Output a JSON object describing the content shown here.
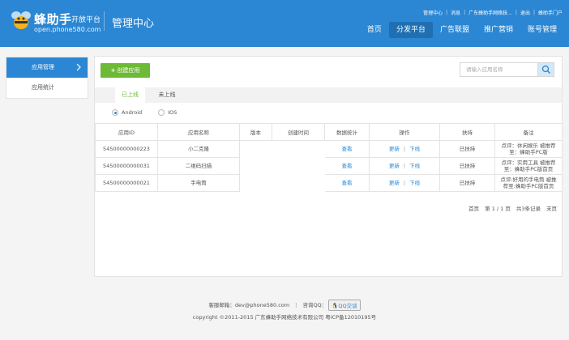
{
  "header": {
    "logo_text": "蜂助手",
    "logo_sub": "开放平台",
    "logo_domain": "open.phone580.com",
    "title": "管理中心",
    "top_links": [
      "管理中心",
      "消息",
      "广东蜂助手网络技...",
      "退出",
      "蜂助手门户"
    ],
    "nav": [
      "首页",
      "分发平台",
      "广告联盟",
      "推广营销",
      "账号管理"
    ],
    "active_nav_index": 1
  },
  "sidebar": {
    "items": [
      "应用管理",
      "应用统计"
    ],
    "active_index": 0
  },
  "toolbar": {
    "create_label": "创建应用",
    "search_placeholder": "请输入应用名称"
  },
  "tabs": [
    "已上线",
    "未上线"
  ],
  "platforms": {
    "options": [
      "Android",
      "IOS"
    ],
    "selected": "Android"
  },
  "table": {
    "headers": [
      "应用ID",
      "应用名称",
      "版本",
      "创建时间",
      "数据统计",
      "操作",
      "扶持",
      "备注"
    ],
    "rows": [
      {
        "id": "54500000000223",
        "name": "小二克隆",
        "version": "",
        "created": "",
        "stats": "查看",
        "op_update": "更新",
        "op_offline": "下线",
        "support": "已扶持",
        "note": "点评：休闲娱乐 被推荐至：蜂助手PC版"
      },
      {
        "id": "54500000000031",
        "name": "二维码扫描",
        "version": "",
        "created": "",
        "stats": "查看",
        "op_update": "更新",
        "op_offline": "下线",
        "support": "已扶持",
        "note": "点评：实用工具 被推荐至：蜂助手PC版首页"
      },
      {
        "id": "54500000000021",
        "name": "手电筒",
        "version": "",
        "created": "",
        "stats": "查看",
        "op_update": "更新",
        "op_offline": "下线",
        "support": "已扶持",
        "note": "点评:好用的手电筒 被推荐至:蜂助手PC版首页"
      }
    ]
  },
  "pager": {
    "first": "首页",
    "page": "第 1 / 1 页",
    "total": "共3条记录",
    "last": "末页"
  },
  "footer": {
    "email_label": "客服邮箱：dev@phone580.com",
    "sep": "|",
    "qq_label": "咨询QQ：",
    "qq_button": "QQ交谈",
    "copyright": "copyright ©2011-2015  广东蜂助手网络技术有限公司  粤ICP备12010195号"
  },
  "colors": {
    "header_bg": "#2b86d3",
    "active_nav_bg": "#1f6fb2",
    "create_button": "#6cba35",
    "link": "#2b86d3"
  }
}
